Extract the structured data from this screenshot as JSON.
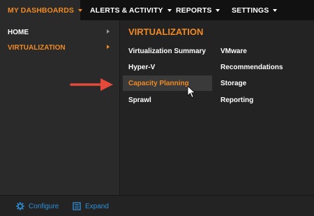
{
  "topnav": {
    "tabs": [
      {
        "label": "MY DASHBOARDS",
        "active": true,
        "caret": true
      },
      {
        "label": "ALERTS & ACTIVITY",
        "active": false,
        "caret": true
      },
      {
        "label": "REPORTS",
        "active": false,
        "caret": true
      },
      {
        "label": "SETTINGS",
        "active": false,
        "caret": true
      }
    ]
  },
  "leftmenu": {
    "items": [
      {
        "label": "HOME",
        "active": false
      },
      {
        "label": "VIRTUALIZATION",
        "active": true
      }
    ]
  },
  "panel": {
    "title": "VIRTUALIZATION",
    "col1": [
      "Virtualization Summary",
      "Hyper-V",
      "Capacity Planning",
      "Sprawl"
    ],
    "col2": [
      "VMware",
      "Recommendations",
      "Storage",
      "Reporting"
    ],
    "hovered": "Capacity Planning"
  },
  "bottombar": {
    "configure_label": "Configure",
    "expand_label": "Expand"
  },
  "colors": {
    "accent": "#f08a24",
    "link_blue": "#2f8fd8",
    "annotation_arrow": "#e5493a"
  }
}
